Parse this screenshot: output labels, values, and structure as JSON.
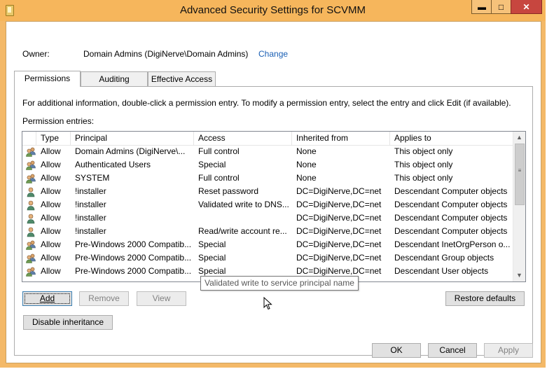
{
  "window": {
    "title": "Advanced Security Settings for SCVMM",
    "app_icon": "folder-icon",
    "controls": {
      "minimize": "▬",
      "maximize": "□",
      "close": "✕"
    }
  },
  "owner": {
    "label": "Owner:",
    "value": "Domain Admins (DigiNerve\\Domain Admins)",
    "change_label": "Change"
  },
  "tabs": [
    {
      "label": "Permissions",
      "active": true
    },
    {
      "label": "Auditing",
      "active": false
    },
    {
      "label": "Effective Access",
      "active": false
    }
  ],
  "permissions": {
    "info": "For additional information, double-click a permission entry. To modify a permission entry, select the entry and click Edit (if available).",
    "entries_label": "Permission entries:",
    "columns": [
      "Type",
      "Principal",
      "Access",
      "Inherited from",
      "Applies to"
    ],
    "rows": [
      {
        "icon": "group-icon",
        "type": "Allow",
        "principal": "Domain Admins (DigiNerve\\...",
        "access": "Full control",
        "inherited": "None",
        "applies": "This object only"
      },
      {
        "icon": "group-icon",
        "type": "Allow",
        "principal": "Authenticated Users",
        "access": "Special",
        "inherited": "None",
        "applies": "This object only"
      },
      {
        "icon": "group-icon",
        "type": "Allow",
        "principal": "SYSTEM",
        "access": "Full control",
        "inherited": "None",
        "applies": "This object only"
      },
      {
        "icon": "user-icon",
        "type": "Allow",
        "principal": "!installer",
        "access": "Reset password",
        "inherited": "DC=DigiNerve,DC=net",
        "applies": "Descendant Computer objects"
      },
      {
        "icon": "user-icon",
        "type": "Allow",
        "principal": "!installer",
        "access": "Validated write to DNS...",
        "inherited": "DC=DigiNerve,DC=net",
        "applies": "Descendant Computer objects"
      },
      {
        "icon": "user-icon",
        "type": "Allow",
        "principal": "!installer",
        "access": "",
        "inherited": "DC=DigiNerve,DC=net",
        "applies": "Descendant Computer objects"
      },
      {
        "icon": "user-icon",
        "type": "Allow",
        "principal": "!installer",
        "access": "Read/write account re...",
        "inherited": "DC=DigiNerve,DC=net",
        "applies": "Descendant Computer objects"
      },
      {
        "icon": "group-icon",
        "type": "Allow",
        "principal": "Pre-Windows 2000 Compatib...",
        "access": "Special",
        "inherited": "DC=DigiNerve,DC=net",
        "applies": "Descendant InetOrgPerson o..."
      },
      {
        "icon": "group-icon",
        "type": "Allow",
        "principal": "Pre-Windows 2000 Compatib...",
        "access": "Special",
        "inherited": "DC=DigiNerve,DC=net",
        "applies": "Descendant Group objects"
      },
      {
        "icon": "group-icon",
        "type": "Allow",
        "principal": "Pre-Windows 2000 Compatib...",
        "access": "Special",
        "inherited": "DC=DigiNerve,DC=net",
        "applies": "Descendant User objects"
      }
    ],
    "tooltip": "Validated write to service principal name"
  },
  "buttons": {
    "add": "Add",
    "remove": "Remove",
    "view": "View",
    "restore_defaults": "Restore defaults",
    "disable_inheritance": "Disable inheritance",
    "ok": "OK",
    "cancel": "Cancel",
    "apply": "Apply"
  },
  "colors": {
    "frame": "#f4b968",
    "close_button": "#c7463f",
    "link": "#1a5fb4"
  }
}
